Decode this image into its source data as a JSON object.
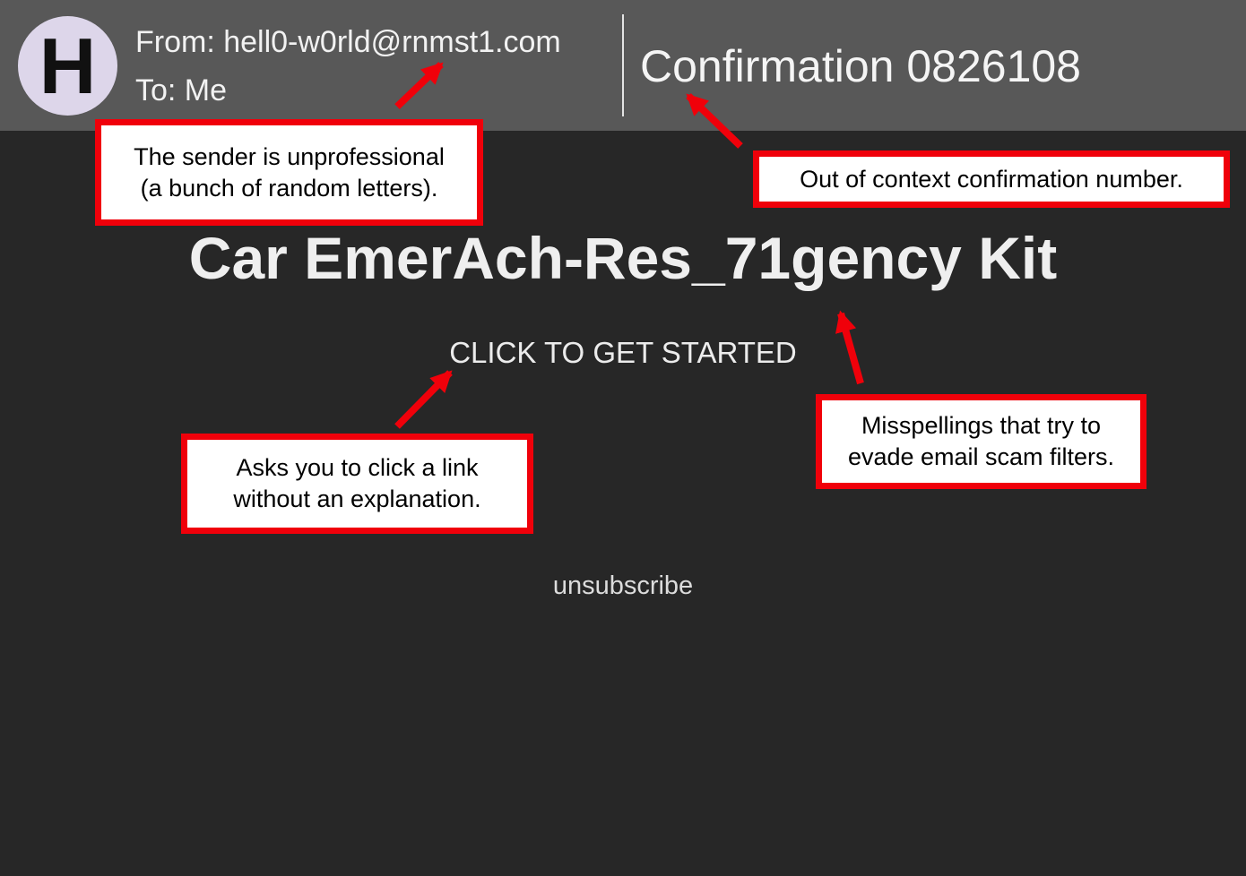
{
  "email": {
    "avatar_letter": "H",
    "from": "From: hell0-w0rld@rnmst1.com",
    "to": "To: Me",
    "subject": "Confirmation 0826108"
  },
  "body": {
    "headline": "Car EmerAch-Res_71gency Kit",
    "cta": "CLICK TO GET STARTED",
    "unsubscribe": "unsubscribe"
  },
  "annotations": {
    "sender": [
      "The sender is unprofessional",
      "(a bunch of random letters)."
    ],
    "confirmation": [
      "Out of context confirmation number."
    ],
    "click": [
      "Asks you to click a link",
      "without an explanation."
    ],
    "misspellings": [
      "Misspellings that try to",
      "evade email scam filters."
    ]
  },
  "colors": {
    "annotation_accent": "#f0000a",
    "header_background": "#585858",
    "body_background": "#272727",
    "avatar_background": "#ddd6ea"
  }
}
